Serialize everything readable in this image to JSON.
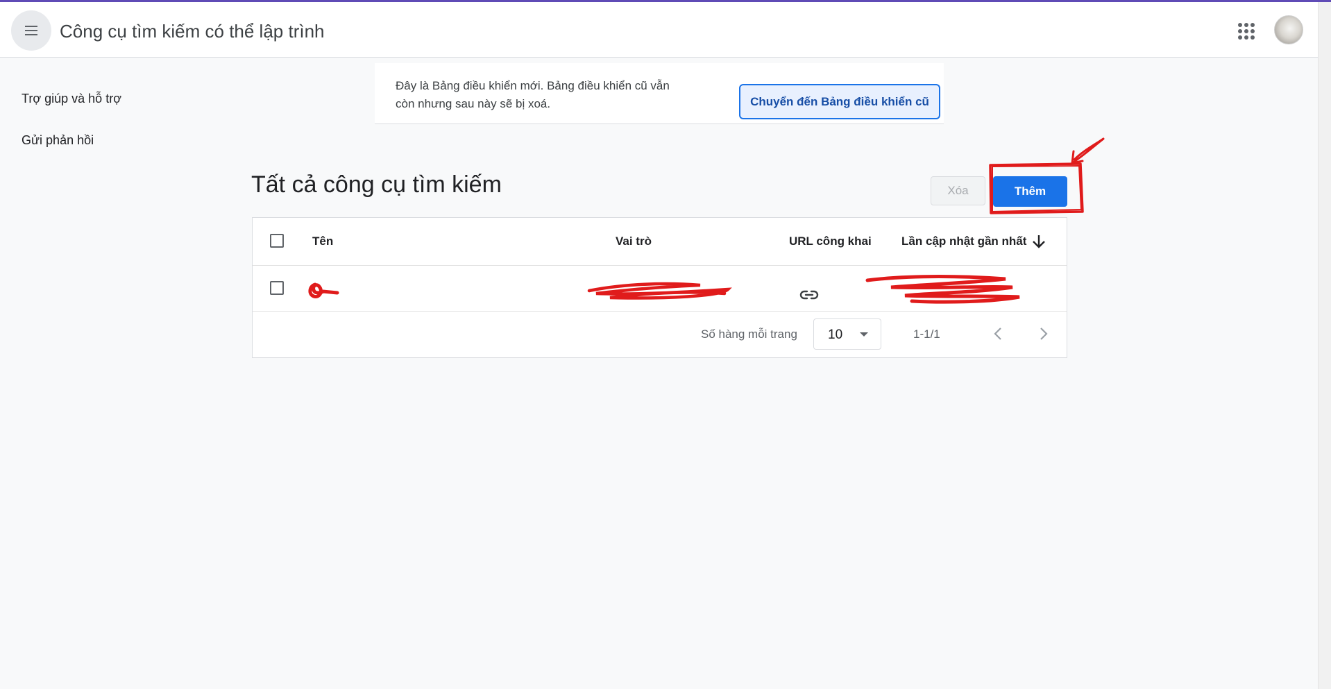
{
  "header": {
    "title": "Công cụ tìm kiếm có thể lập trình"
  },
  "sidebar": {
    "items": [
      {
        "label": "Trợ giúp và hỗ trợ"
      },
      {
        "label": "Gửi phản hồi"
      }
    ]
  },
  "banner": {
    "text": "Đây là Bảng điều khiển mới. Bảng điều khiển cũ vẫn còn nhưng sau này sẽ bị xoá.",
    "button_label": "Chuyển đến Bảng điều khiển cũ"
  },
  "main": {
    "title": "Tất cả công cụ tìm kiếm",
    "delete_label": "Xóa",
    "add_label": "Thêm"
  },
  "table": {
    "columns": [
      "Tên",
      "Vai trò",
      "URL công khai",
      "Lần cập nhật gần nhất"
    ],
    "sort": "descending",
    "rows": [
      {
        "name": "",
        "role": "",
        "url_icon": "link-icon",
        "updated": ""
      }
    ]
  },
  "pagination": {
    "rows_per_page_label": "Số hàng mỗi trang",
    "rows_per_page": "10",
    "range": "1-1/1"
  },
  "colors": {
    "primary": "#1a73e8",
    "annotation": "#e01b1b"
  }
}
